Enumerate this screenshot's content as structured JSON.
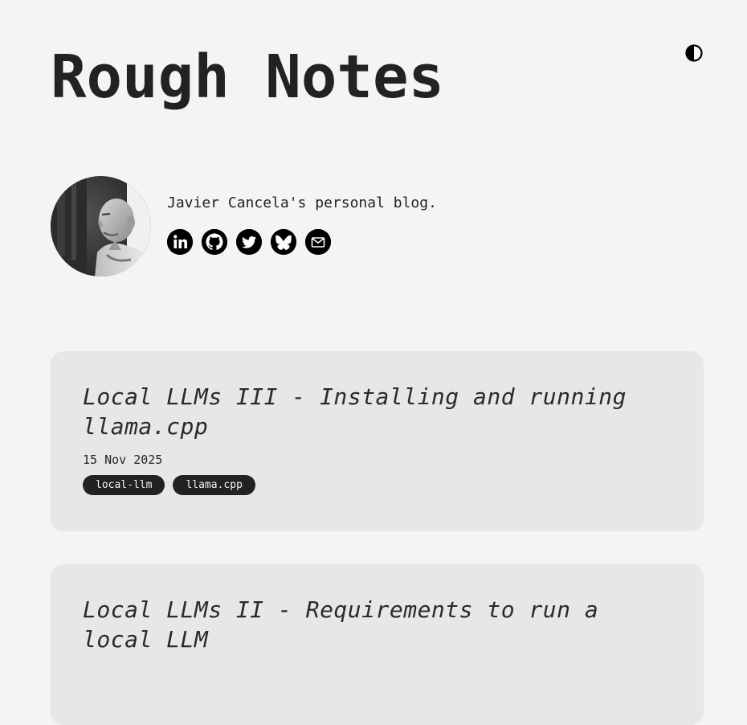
{
  "header": {
    "site_title": "Rough Notes",
    "theme_toggle_icon": "contrast-half-circle-icon"
  },
  "profile": {
    "tagline": "Javier Cancela's personal blog.",
    "social_links": [
      {
        "name": "linkedin",
        "icon": "linkedin-icon"
      },
      {
        "name": "github",
        "icon": "github-icon"
      },
      {
        "name": "twitter",
        "icon": "twitter-icon"
      },
      {
        "name": "bluesky",
        "icon": "bluesky-icon"
      },
      {
        "name": "email",
        "icon": "email-icon"
      }
    ]
  },
  "posts": [
    {
      "title": "Local LLMs III - Installing and running llama.cpp",
      "date": "15 Nov 2025",
      "tags": [
        "local-llm",
        "llama.cpp"
      ]
    },
    {
      "title": "Local LLMs II - Requirements to run a local LLM"
    }
  ],
  "colors": {
    "background": "#f4f4f4",
    "card": "#e7e7e7",
    "text": "#222222",
    "tag_bg": "#222222",
    "tag_text": "#f4f4f4"
  }
}
